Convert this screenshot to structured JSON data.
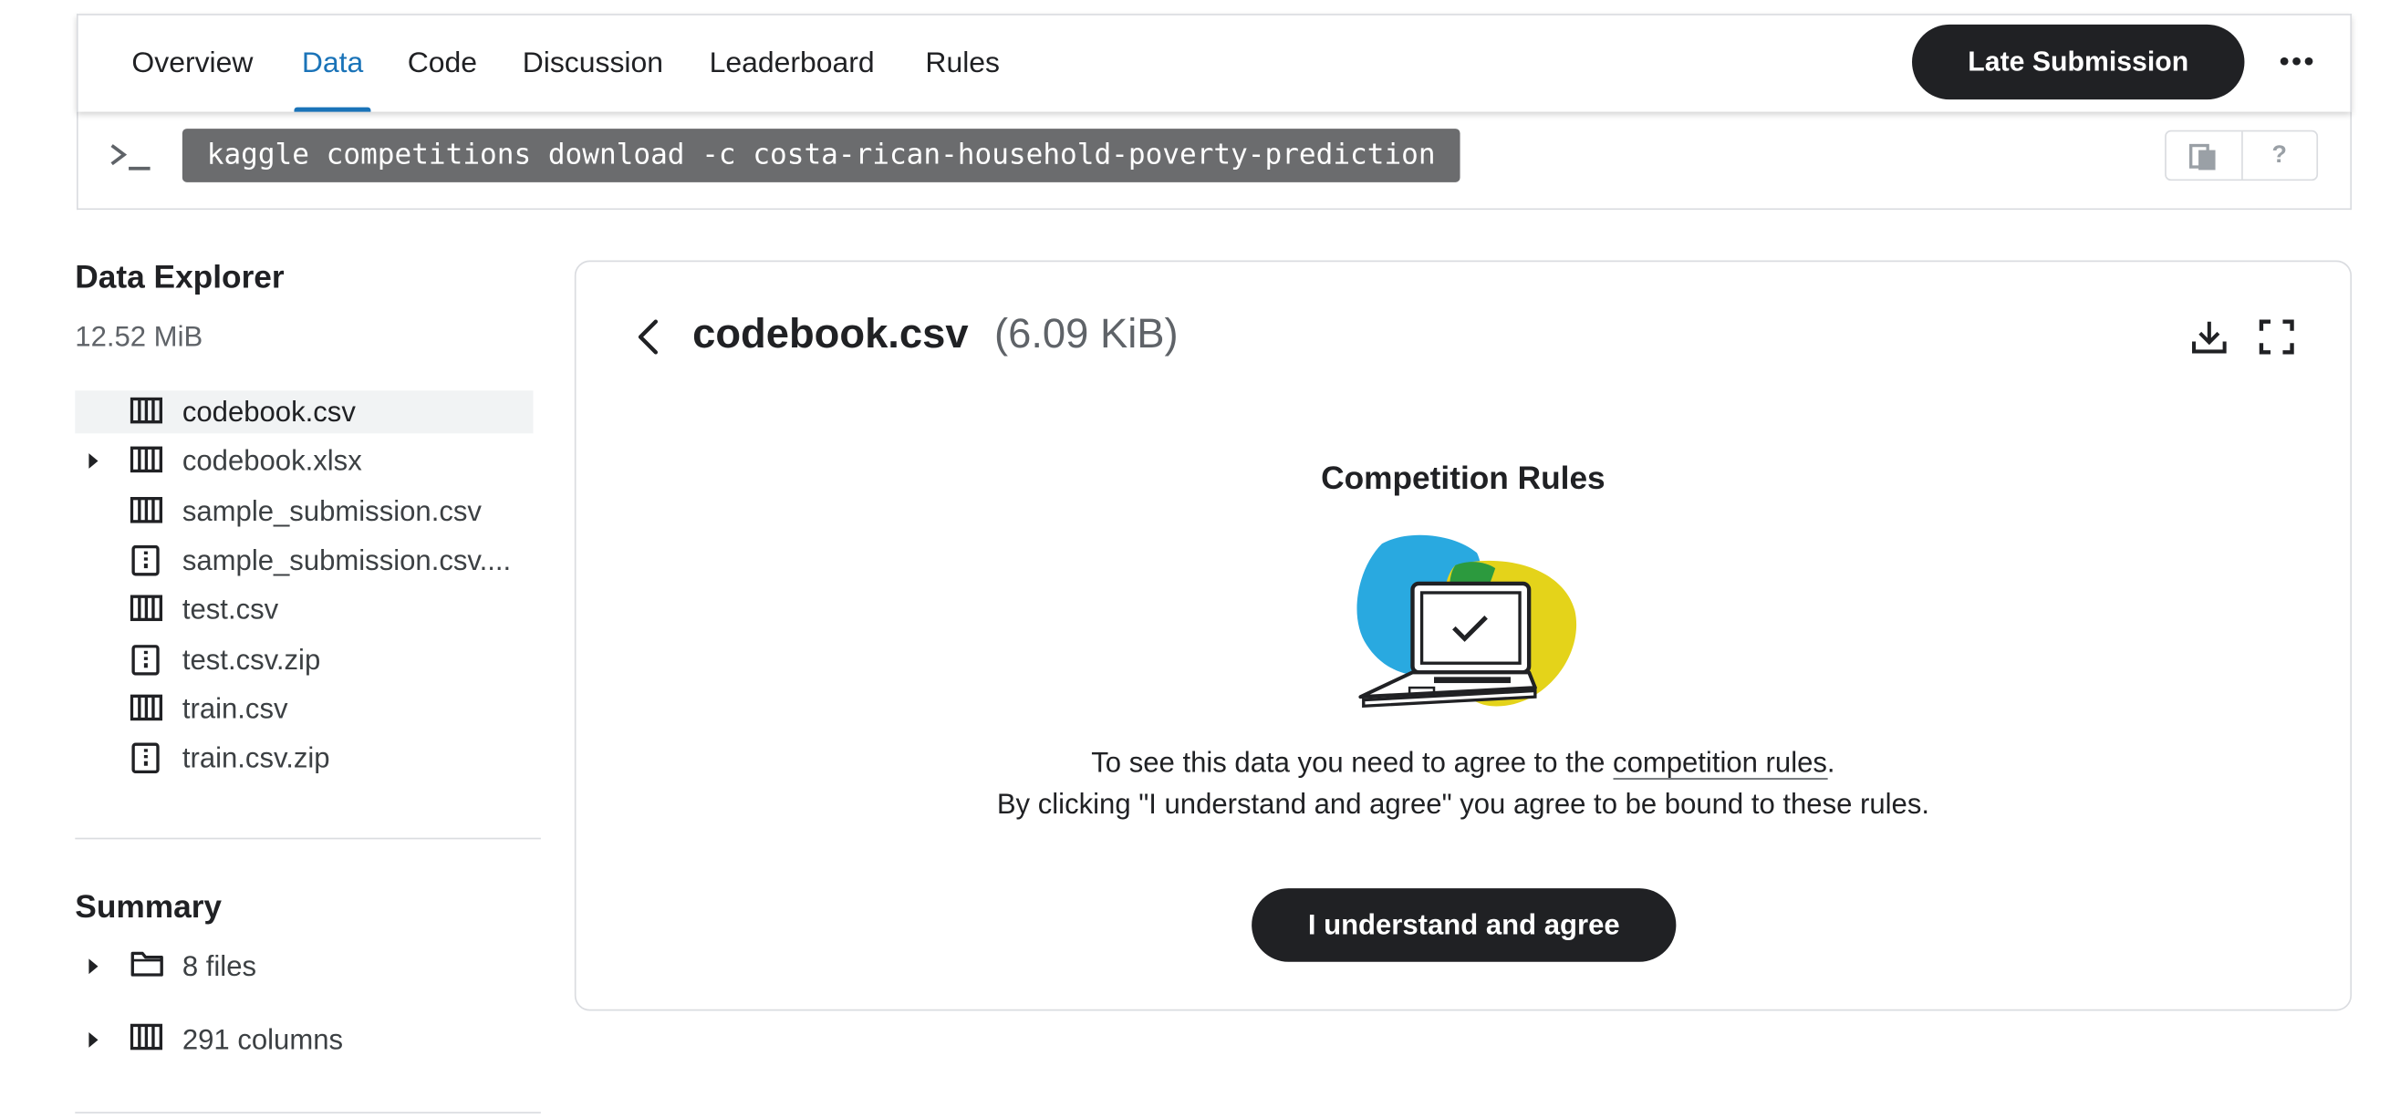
{
  "nav": {
    "tabs": [
      {
        "label": "Overview"
      },
      {
        "label": "Data"
      },
      {
        "label": "Code"
      },
      {
        "label": "Discussion"
      },
      {
        "label": "Leaderboard"
      },
      {
        "label": "Rules"
      }
    ],
    "active_tab": "Data",
    "late_submission_label": "Late Submission",
    "more_icon": "more-horizontal-icon"
  },
  "command_bar": {
    "prompt_icon": "terminal-prompt-icon",
    "command": "kaggle competitions download -c costa-rican-household-poverty-prediction",
    "copy_icon": "copy-icon",
    "help_label": "?"
  },
  "sidebar": {
    "title": "Data Explorer",
    "size": "12.52 MiB",
    "files": [
      {
        "name": "codebook.csv",
        "icon": "table-icon",
        "selected": true,
        "expandable": false
      },
      {
        "name": "codebook.xlsx",
        "icon": "table-icon",
        "selected": false,
        "expandable": true
      },
      {
        "name": "sample_submission.csv",
        "icon": "table-icon",
        "selected": false,
        "expandable": false
      },
      {
        "name": "sample_submission.csv....",
        "icon": "zip-file-icon",
        "selected": false,
        "expandable": false
      },
      {
        "name": "test.csv",
        "icon": "table-icon",
        "selected": false,
        "expandable": false
      },
      {
        "name": "test.csv.zip",
        "icon": "zip-file-icon",
        "selected": false,
        "expandable": false
      },
      {
        "name": "train.csv",
        "icon": "table-icon",
        "selected": false,
        "expandable": false
      },
      {
        "name": "train.csv.zip",
        "icon": "zip-file-icon",
        "selected": false,
        "expandable": false
      }
    ],
    "summary": {
      "title": "Summary",
      "items": [
        {
          "label": "8 files",
          "icon": "folder-icon"
        },
        {
          "label": "291 columns",
          "icon": "table-icon"
        }
      ]
    }
  },
  "main": {
    "file_name": "codebook.csv",
    "file_size": "(6.09 KiB)",
    "rules_title": "Competition Rules",
    "notice_line1_prefix": "To see this data you need to agree to the ",
    "notice_link": "competition rules",
    "notice_line1_suffix": ".",
    "notice_line2": "By clicking \"I understand and agree\" you agree to be bound to these rules.",
    "agree_label": "I understand and agree"
  },
  "colors": {
    "accent": "#1a73b8",
    "button_dark": "#202124",
    "command_bg": "#6b6c6e",
    "illustration_blue": "#29a9e0",
    "illustration_yellow": "#e4d31a",
    "illustration_green": "#2c9a3e"
  }
}
